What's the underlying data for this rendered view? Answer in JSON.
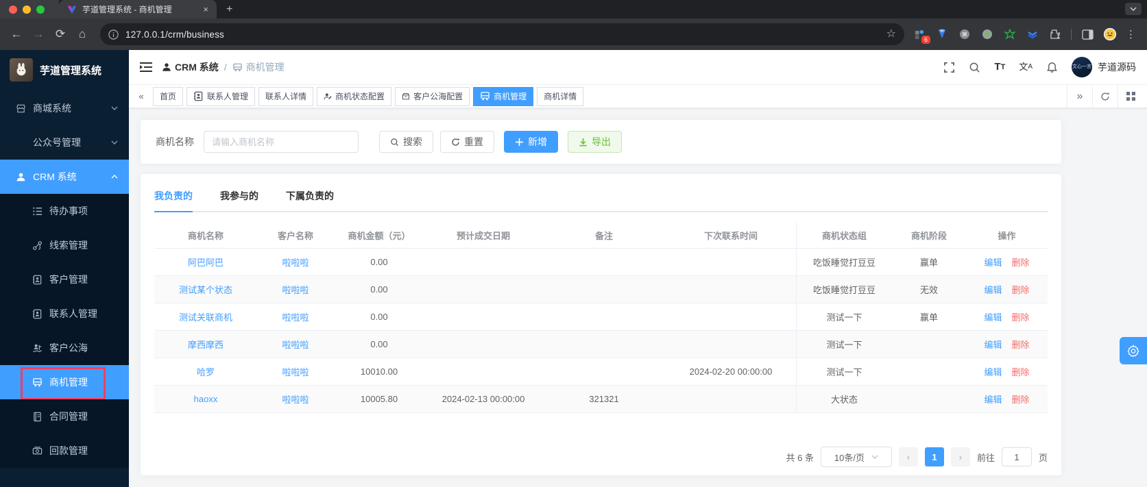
{
  "colors": {
    "accent": "#409eff",
    "danger": "#f56c6c",
    "success": "#67c23a",
    "annotation": "#f43f5e",
    "sidebar_bg": "#0b1f33"
  },
  "browser": {
    "tab_title": "芋道管理系统 - 商机管理",
    "close_glyph": "×",
    "newtab_glyph": "+",
    "url": "127.0.0.1/crm/business",
    "extension_badge": "6"
  },
  "sidebar": {
    "logo_title": "芋道管理系统",
    "menu": [
      {
        "label": "商城系统",
        "icon": "shop",
        "type": "group",
        "chevron": "down"
      },
      {
        "label": "公众号管理",
        "icon": "",
        "type": "group",
        "chevron": "down"
      },
      {
        "label": "CRM 系统",
        "icon": "user",
        "type": "group",
        "chevron": "up",
        "active": true
      },
      {
        "label": "待办事项",
        "icon": "todo",
        "type": "sub"
      },
      {
        "label": "线索管理",
        "icon": "clue",
        "type": "sub"
      },
      {
        "label": "客户管理",
        "icon": "customer",
        "type": "sub"
      },
      {
        "label": "联系人管理",
        "icon": "contact",
        "type": "sub"
      },
      {
        "label": "客户公海",
        "icon": "pool",
        "type": "sub"
      },
      {
        "label": "商机管理",
        "icon": "business",
        "type": "sub",
        "active": true,
        "annotated": true
      },
      {
        "label": "合同管理",
        "icon": "contract",
        "type": "sub"
      },
      {
        "label": "回款管理",
        "icon": "receivable",
        "type": "sub"
      }
    ]
  },
  "navbar": {
    "breadcrumb": [
      {
        "label": "CRM 系统",
        "icon": "user"
      },
      {
        "label": "商机管理",
        "icon": "business"
      }
    ],
    "separator": "/",
    "username": "芋道源码",
    "avatar_text": "文心一言"
  },
  "tags": [
    {
      "label": "首页"
    },
    {
      "label": "联系人管理",
      "icon": "contact"
    },
    {
      "label": "联系人详情"
    },
    {
      "label": "商机状态配置",
      "icon": "status"
    },
    {
      "label": "客户公海配置",
      "icon": "poolcfg"
    },
    {
      "label": "商机管理",
      "icon": "business",
      "active": true
    },
    {
      "label": "商机详情"
    }
  ],
  "filter": {
    "label": "商机名称",
    "placeholder": "请输入商机名称",
    "search_label": "搜索",
    "reset_label": "重置",
    "add_label": "新增",
    "export_label": "导出"
  },
  "panel": {
    "tabs": [
      {
        "label": "我负责的",
        "active": true
      },
      {
        "label": "我参与的"
      },
      {
        "label": "下属负责的"
      }
    ]
  },
  "table": {
    "columns": [
      "商机名称",
      "客户名称",
      "商机金额（元）",
      "预计成交日期",
      "备注",
      "下次联系时间",
      "商机状态组",
      "商机阶段",
      "操作"
    ],
    "edit_label": "编辑",
    "delete_label": "删除",
    "rows": [
      {
        "name": "阿巴阿巴",
        "customer": "啦啦啦",
        "amount": "0.00",
        "deal_date": "",
        "remark": "",
        "next_contact": "",
        "status_group": "吃饭睡觉打豆豆",
        "stage": "赢单"
      },
      {
        "name": "测试某个状态",
        "customer": "啦啦啦",
        "amount": "0.00",
        "deal_date": "",
        "remark": "",
        "next_contact": "",
        "status_group": "吃饭睡觉打豆豆",
        "stage": "无效"
      },
      {
        "name": "测试关联商机",
        "customer": "啦啦啦",
        "amount": "0.00",
        "deal_date": "",
        "remark": "",
        "next_contact": "",
        "status_group": "测试一下",
        "stage": "赢单"
      },
      {
        "name": "摩西摩西",
        "customer": "啦啦啦",
        "amount": "0.00",
        "deal_date": "",
        "remark": "",
        "next_contact": "",
        "status_group": "测试一下",
        "stage": ""
      },
      {
        "name": "哈罗",
        "customer": "啦啦啦",
        "amount": "10010.00",
        "deal_date": "",
        "remark": "",
        "next_contact": "2024-02-20 00:00:00",
        "status_group": "测试一下",
        "stage": ""
      },
      {
        "name": "haoxx",
        "customer": "啦啦啦",
        "amount": "10005.80",
        "deal_date": "2024-02-13 00:00:00",
        "remark": "321321",
        "next_contact": "",
        "status_group": "大状态",
        "stage": ""
      }
    ]
  },
  "pagination": {
    "total": "共 6 条",
    "page_size": "10条/页",
    "page": "1",
    "prev": "‹",
    "next": "›",
    "goto_label": "前往",
    "goto_value": "1",
    "unit_label": "页"
  }
}
